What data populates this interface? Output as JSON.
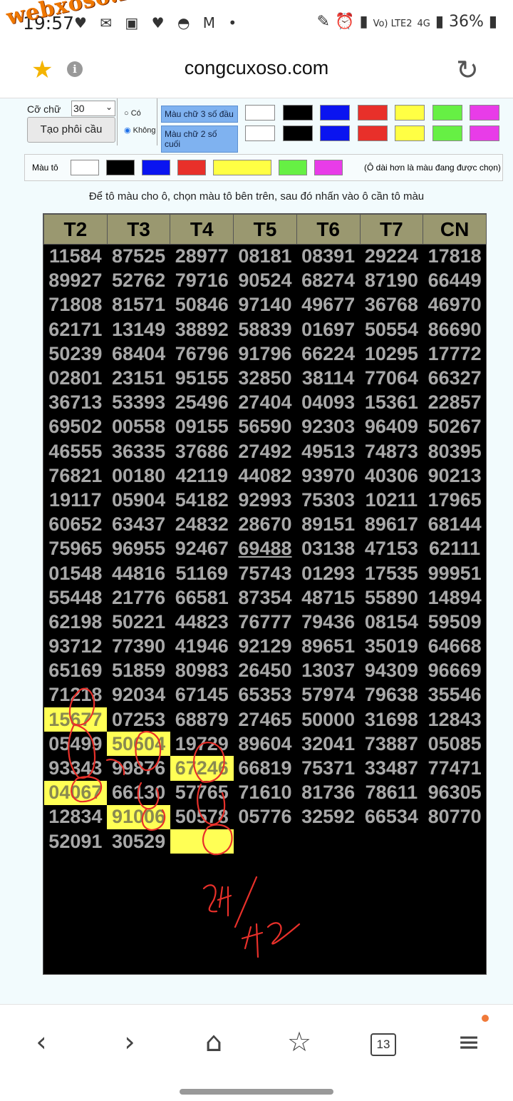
{
  "status": {
    "time": "19:57",
    "battery": "36%",
    "net1": "Vo) LTE2",
    "net2": "4G"
  },
  "watermark": "webxoso.net",
  "browser": {
    "url": "congcuxoso.com"
  },
  "controls": {
    "font_size_label": "Cỡ chữ",
    "font_size_value": "30",
    "create_button": "Tạo phôi cầu",
    "radio_yes": "Có",
    "radio_no": "Không",
    "row1_label": "Màu chữ 3 số đầu",
    "row2_label": "Màu chữ 2 số cuối",
    "fill_label": "Màu tô",
    "fill_note": "(Ô dài hơn là màu đang được chọn)",
    "instruction": "Để tô màu cho ô, chọn màu tô bên trên, sau đó nhấn vào ô cần tô màu",
    "swatch_colors": [
      "#ffffff",
      "#000000",
      "#0a14f0",
      "#e8302a",
      "#ffff44",
      "#66f044",
      "#e83ce8"
    ]
  },
  "grid": {
    "headers": [
      "T2",
      "T3",
      "T4",
      "T5",
      "T6",
      "T7",
      "CN"
    ],
    "rows": [
      [
        "11584",
        "87525",
        "28977",
        "08181",
        "08391",
        "29224",
        "17818"
      ],
      [
        "89927",
        "52762",
        "79716",
        "90524",
        "68274",
        "87190",
        "66449"
      ],
      [
        "71808",
        "81571",
        "50846",
        "97140",
        "49677",
        "36768",
        "46970"
      ],
      [
        "62171",
        "13149",
        "38892",
        "58839",
        "01697",
        "50554",
        "86690"
      ],
      [
        "50239",
        "68404",
        "76796",
        "91796",
        "66224",
        "10295",
        "17772"
      ],
      [
        "02801",
        "23151",
        "95155",
        "32850",
        "38114",
        "77064",
        "66327"
      ],
      [
        "36713",
        "53393",
        "25496",
        "27404",
        "04093",
        "15361",
        "22857"
      ],
      [
        "69502",
        "00558",
        "09155",
        "56590",
        "92303",
        "96409",
        "50267"
      ],
      [
        "46555",
        "36335",
        "37686",
        "27492",
        "49513",
        "74873",
        "80395"
      ],
      [
        "76821",
        "00180",
        "42119",
        "44082",
        "93970",
        "40306",
        "90213"
      ],
      [
        "19117",
        "05904",
        "54182",
        "92993",
        "75303",
        "10211",
        "17965"
      ],
      [
        "60652",
        "63437",
        "24832",
        "28670",
        "89151",
        "89617",
        "68144"
      ],
      [
        "75965",
        "96955",
        "92467",
        "69488",
        "03138",
        "47153",
        "62111"
      ],
      [
        "01548",
        "44816",
        "51169",
        "75743",
        "01293",
        "17535",
        "99951"
      ],
      [
        "55448",
        "21776",
        "66581",
        "87354",
        "48715",
        "55890",
        "14894"
      ],
      [
        "62198",
        "50221",
        "44823",
        "76777",
        "79436",
        "08154",
        "59509"
      ],
      [
        "93712",
        "77390",
        "41946",
        "92129",
        "89651",
        "35019",
        "64668"
      ],
      [
        "65169",
        "51859",
        "80983",
        "26450",
        "13037",
        "94309",
        "96669"
      ],
      [
        "71218",
        "92034",
        "67145",
        "65353",
        "57974",
        "79638",
        "35546"
      ],
      [
        "15677",
        "07253",
        "68879",
        "27465",
        "50000",
        "31698",
        "12843"
      ],
      [
        "05499",
        "50604",
        "19729",
        "89604",
        "32041",
        "73887",
        "05085"
      ],
      [
        "93343",
        "99876",
        "67246",
        "66819",
        "75371",
        "33487",
        "77471"
      ],
      [
        "04067",
        "66130",
        "57765",
        "71610",
        "81736",
        "78611",
        "96305"
      ],
      [
        "12834",
        "91006",
        "50578",
        "05776",
        "32592",
        "66534",
        "80770"
      ],
      [
        "52091",
        "30529",
        "",
        "",
        "",
        "",
        ""
      ]
    ],
    "highlighted": [
      "19-0",
      "20-1",
      "21-2",
      "22-0",
      "23-1",
      "24-2"
    ],
    "underlined": [
      "12-3"
    ]
  },
  "annotation": {
    "handwritten_note": "24/42",
    "stroke_color": "#e8302a"
  }
}
